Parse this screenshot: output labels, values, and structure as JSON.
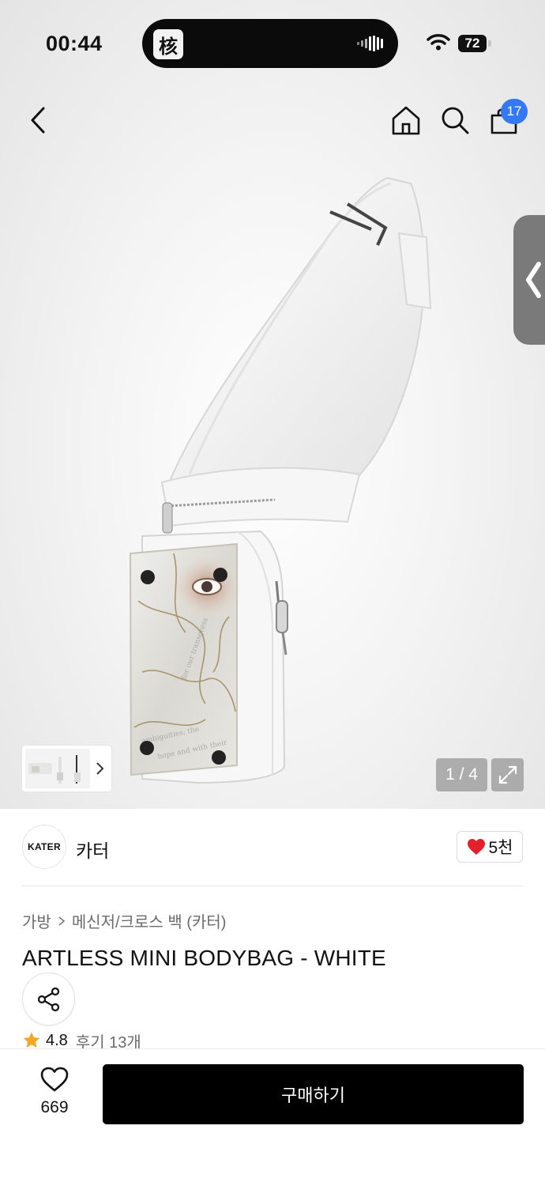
{
  "status_bar": {
    "time": "00:44",
    "battery": "72",
    "island_app_glyph": "核"
  },
  "header": {
    "cart_count": "17",
    "icons": [
      "back-chevron-icon",
      "home-icon",
      "search-icon",
      "shopping-bag-icon"
    ]
  },
  "gallery": {
    "page_counter": "1 / 4",
    "current_page": 1,
    "total_pages": 4
  },
  "brand": {
    "logo_text": "KATER",
    "name": "카터",
    "likes": "5천",
    "like_color": "#e4202a"
  },
  "breadcrumb": [
    "가방",
    "메신저/크로스 백 (카터)"
  ],
  "product": {
    "title": "ARTLESS MINI BODYBAG - WHITE"
  },
  "rating": {
    "score": "4.8",
    "reviews": "후기 13개",
    "star_color": "#f5a623"
  },
  "bottom_bar": {
    "wish_count": "669",
    "buy_label": "구매하기"
  }
}
